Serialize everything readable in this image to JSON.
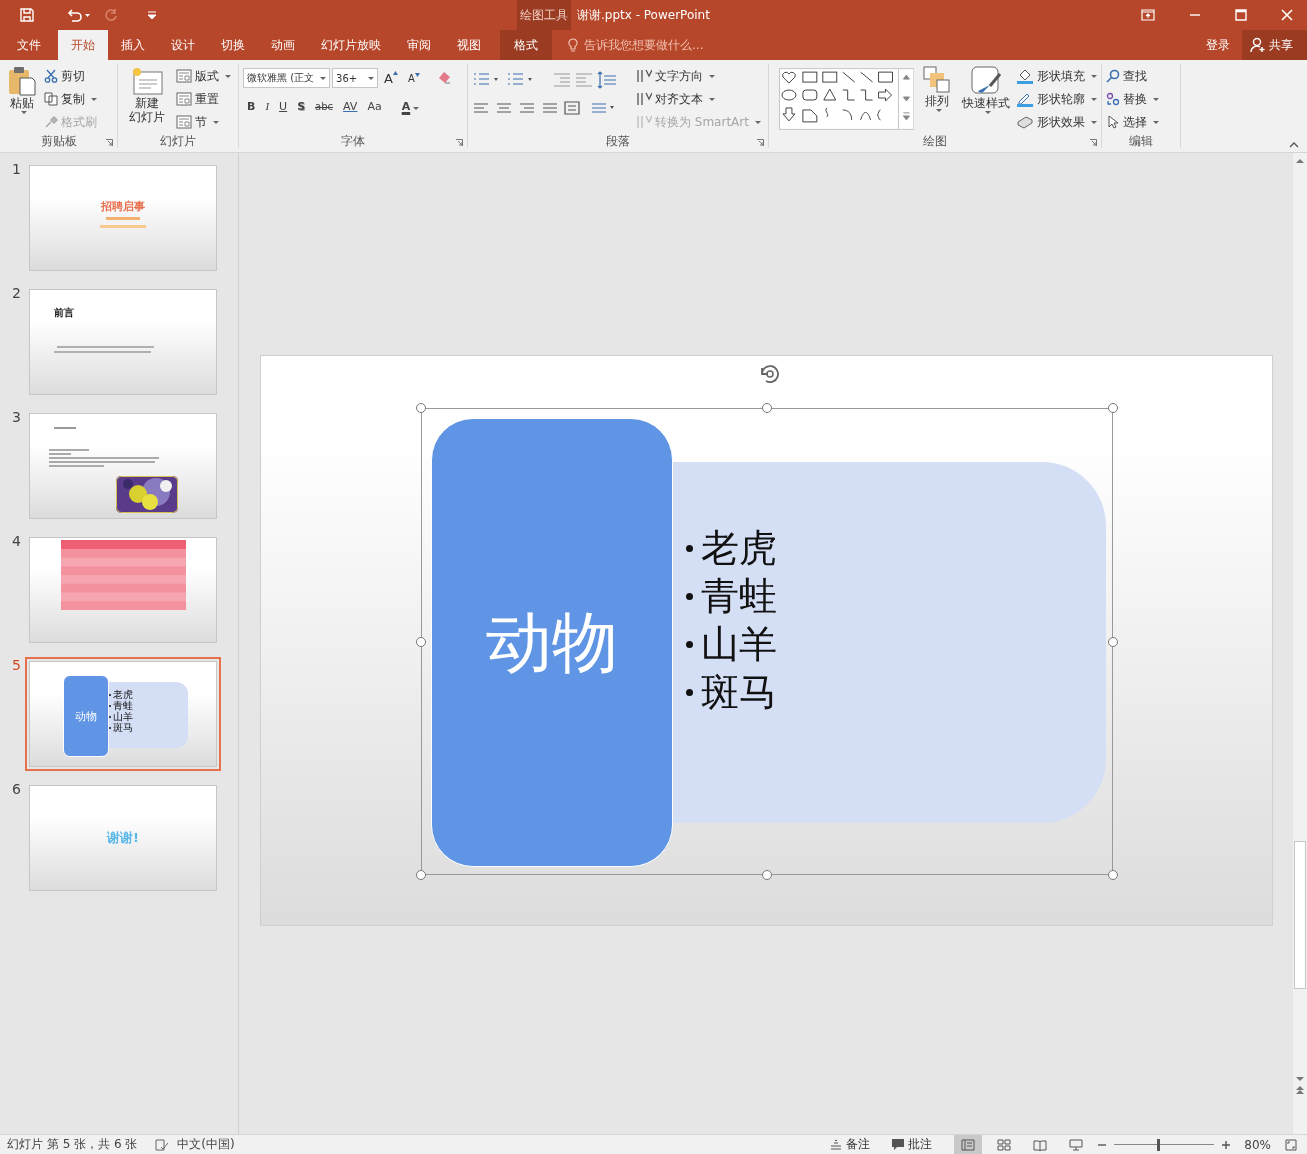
{
  "title_bar": {
    "context_label": "绘图工具",
    "title": "谢谢.pptx - PowerPoint",
    "redo_disabled": true
  },
  "tabs": [
    {
      "label": "文件",
      "selected": false,
      "kind": "file"
    },
    {
      "label": "开始",
      "selected": true,
      "kind": "normal"
    },
    {
      "label": "插入",
      "selected": false,
      "kind": "normal"
    },
    {
      "label": "设计",
      "selected": false,
      "kind": "normal"
    },
    {
      "label": "切换",
      "selected": false,
      "kind": "normal"
    },
    {
      "label": "动画",
      "selected": false,
      "kind": "normal"
    },
    {
      "label": "幻灯片放映",
      "selected": false,
      "kind": "normal"
    },
    {
      "label": "审阅",
      "selected": false,
      "kind": "normal"
    },
    {
      "label": "视图",
      "selected": false,
      "kind": "normal"
    },
    {
      "label": "格式",
      "selected": false,
      "kind": "context"
    }
  ],
  "tell_me": {
    "placeholder": "告诉我您想要做什么..."
  },
  "sign_in": "登录",
  "share": "共享",
  "clipboard": {
    "label": "剪贴板",
    "paste": "粘贴",
    "items": [
      {
        "label": "剪切",
        "disabled": false,
        "dropdown": false
      },
      {
        "label": "复制",
        "disabled": false,
        "dropdown": true
      },
      {
        "label": "格式刷",
        "disabled": true,
        "dropdown": false
      }
    ]
  },
  "slides_group": {
    "label": "幻灯片",
    "new_slide": [
      "新建",
      "幻灯片"
    ],
    "items": [
      {
        "label": "版式",
        "dropdown": true
      },
      {
        "label": "重置",
        "dropdown": false
      },
      {
        "label": "节",
        "dropdown": true
      }
    ]
  },
  "font": {
    "label": "字体",
    "font_name": "微软雅黑 (正文",
    "font_size": "36+",
    "grow": "A",
    "shrink": "A",
    "format": [
      "B",
      "I",
      "U",
      "S",
      "abc",
      "AV",
      "Aa"
    ],
    "font_color": "A"
  },
  "paragraph": {
    "label": "段落",
    "items": [
      {
        "label": "文字方向",
        "disabled": false
      },
      {
        "label": "对齐文本",
        "disabled": false
      },
      {
        "label": "转换为 SmartArt",
        "disabled": true
      }
    ]
  },
  "drawing": {
    "label": "绘图",
    "arrange": "排列",
    "quick_styles": "快速样式",
    "items": [
      {
        "label": "形状填充"
      },
      {
        "label": "形状轮廓"
      },
      {
        "label": "形状效果"
      }
    ]
  },
  "editing": {
    "label": "编辑",
    "items": [
      {
        "label": "查找",
        "dropdown": false
      },
      {
        "label": "替换",
        "dropdown": true
      },
      {
        "label": "选择",
        "dropdown": true
      }
    ]
  },
  "slides": [
    {
      "number": "1",
      "selected": false,
      "kind": "title",
      "title": "招聘启事"
    },
    {
      "number": "2",
      "selected": false,
      "kind": "text",
      "title": "前言"
    },
    {
      "number": "3",
      "selected": false
    },
    {
      "number": "4",
      "selected": false,
      "kind": "table"
    },
    {
      "number": "5",
      "selected": true,
      "kind": "smartart",
      "title": "动物",
      "bullets": [
        "老虎",
        "青蛙",
        "山羊",
        "斑马"
      ]
    },
    {
      "number": "6",
      "selected": false,
      "kind": "closing",
      "title": "谢谢!"
    }
  ],
  "slide": {
    "title": "动物",
    "bullets": [
      "老虎",
      "青蛙",
      "山羊",
      "斑马"
    ]
  },
  "status": {
    "slide_info": "幻灯片 第 5 张，共 6 张",
    "language": "中文(中国)",
    "notes": "备注",
    "comments": "批注",
    "views": [
      {
        "kind": "normal",
        "selected": true
      },
      {
        "kind": "sorter",
        "selected": false
      },
      {
        "kind": "reading",
        "selected": false
      },
      {
        "kind": "slideshow",
        "selected": false
      }
    ],
    "zoom": {
      "level": 0.43
    },
    "zoom_text": "80%"
  }
}
